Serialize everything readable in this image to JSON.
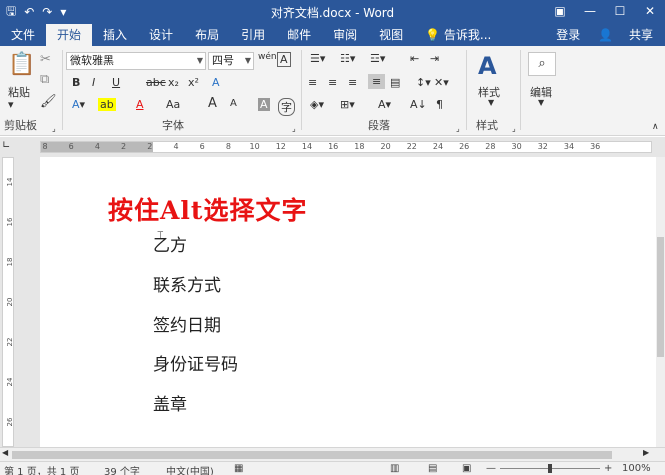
{
  "window": {
    "title": "对齐文档.docx - Word",
    "controls": [
      "minimize",
      "maximize",
      "close"
    ]
  },
  "quick_access": {
    "icons": [
      "save-icon",
      "undo-icon",
      "redo-icon",
      "customize-icon"
    ]
  },
  "tabs": [
    {
      "label": "文件"
    },
    {
      "label": "开始",
      "active": true
    },
    {
      "label": "插入"
    },
    {
      "label": "设计"
    },
    {
      "label": "布局"
    },
    {
      "label": "引用"
    },
    {
      "label": "邮件"
    },
    {
      "label": "审阅"
    },
    {
      "label": "视图"
    }
  ],
  "tell_me": "告诉我...",
  "signin": "登录",
  "share": "共享",
  "ribbon": {
    "clipboard": {
      "paste": "粘贴",
      "group": "剪贴板"
    },
    "font": {
      "font_name": "微软雅黑",
      "font_size": "四号",
      "group": "字体",
      "buttons": [
        "B",
        "I",
        "U",
        "abc",
        "x₂",
        "x²",
        "A",
        "Aa",
        "A",
        "A"
      ]
    },
    "paragraph": {
      "group": "段落"
    },
    "styles": {
      "label": "样式",
      "group": "样式"
    },
    "editing": {
      "label": "编辑"
    }
  },
  "ruler": {
    "marks": [
      "8",
      "6",
      "4",
      "2",
      "2",
      "4",
      "6",
      "8",
      "10",
      "12",
      "14",
      "16",
      "18",
      "20",
      "22",
      "24",
      "26",
      "28",
      "30",
      "32",
      "34",
      "36"
    ],
    "vmarks": [
      "14",
      "16",
      "18",
      "20",
      "22",
      "24",
      "26"
    ]
  },
  "document": {
    "heading": "按住Alt选择文字",
    "lines": [
      "乙方",
      "联系方式",
      "签约日期",
      "身份证号码",
      "盖章"
    ]
  },
  "status": {
    "page": "第 1 页，共 1 页",
    "words": "39 个字",
    "language": "中文(中国)",
    "zoom": "100%"
  },
  "colors": {
    "brand": "#2b579a",
    "heading": "#e81313"
  }
}
